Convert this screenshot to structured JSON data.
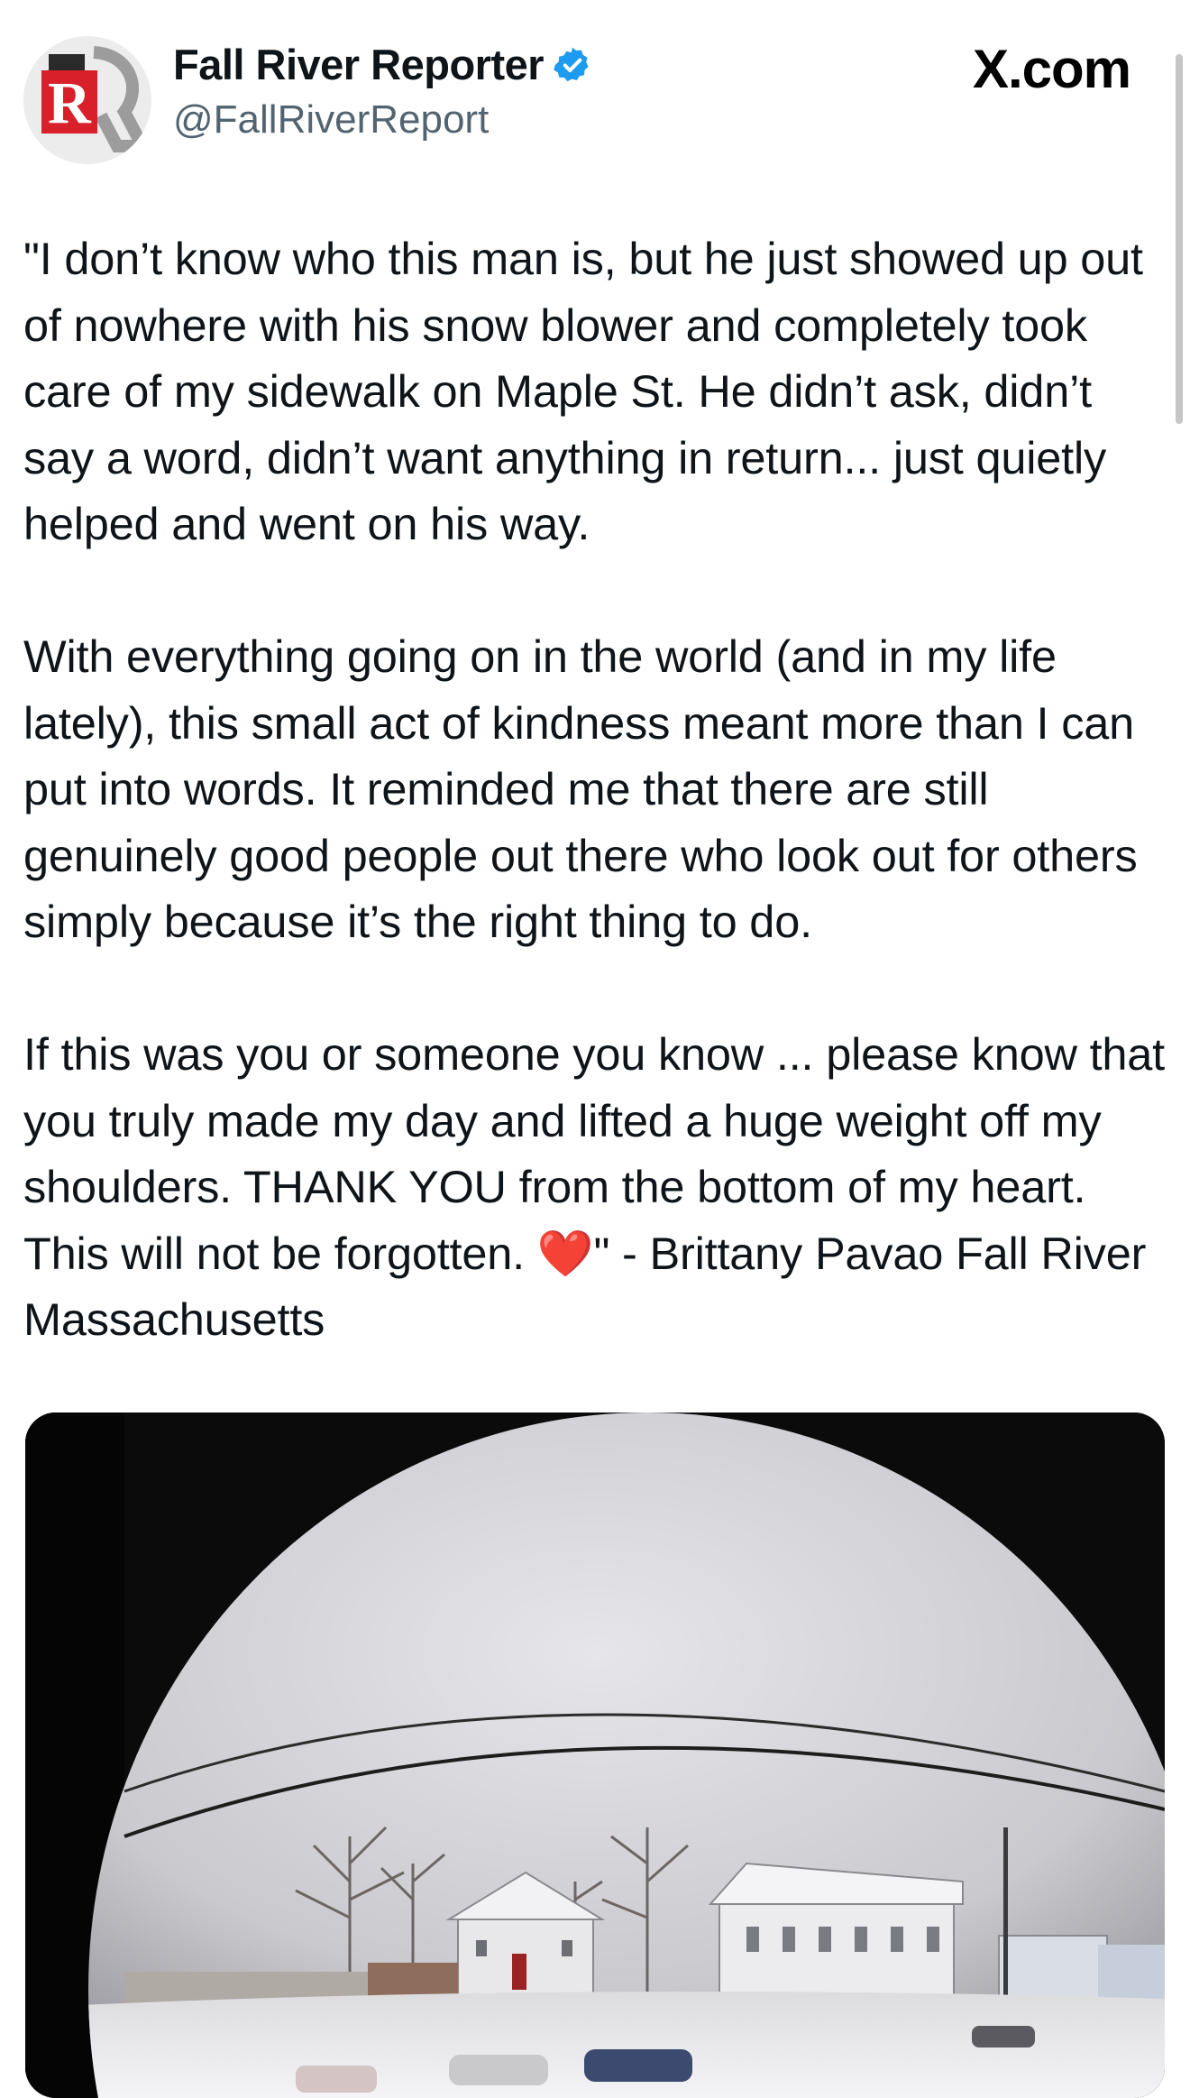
{
  "header": {
    "display_name": "Fall River Reporter",
    "handle": "@FallRiverReport",
    "verified": true,
    "avatar_letter": "R",
    "avatar_icon": "fall-river-reporter-logo",
    "watermark": "X.com",
    "accent_color": "#1d9bf0",
    "brand_red": "#d8202a"
  },
  "tweet": {
    "text": "\"I don’t know who this man is, but he just showed up out of nowhere with his snow blower and completely took care of my sidewalk on Maple St. He didn’t ask, didn’t say a word, didn’t want anything in return... just quietly helped and went on his way.\n\nWith everything going on in the world (and in my life lately), this small act of kindness meant more than I can put into words. It reminded me that there are still genuinely good people out there who look out for others simply because it’s the right thing to do.\n\nIf this was you or someone you know ... please know that you truly made my day and lifted a huge weight off my shoulders. THANK YOU from the bottom of my heart. This will not be forgotten. ❤️\" - Brittany Pavao Fall River Massachusetts"
  },
  "media": {
    "type": "image",
    "icon": "snowy-street-doorbell-camera-photo"
  }
}
